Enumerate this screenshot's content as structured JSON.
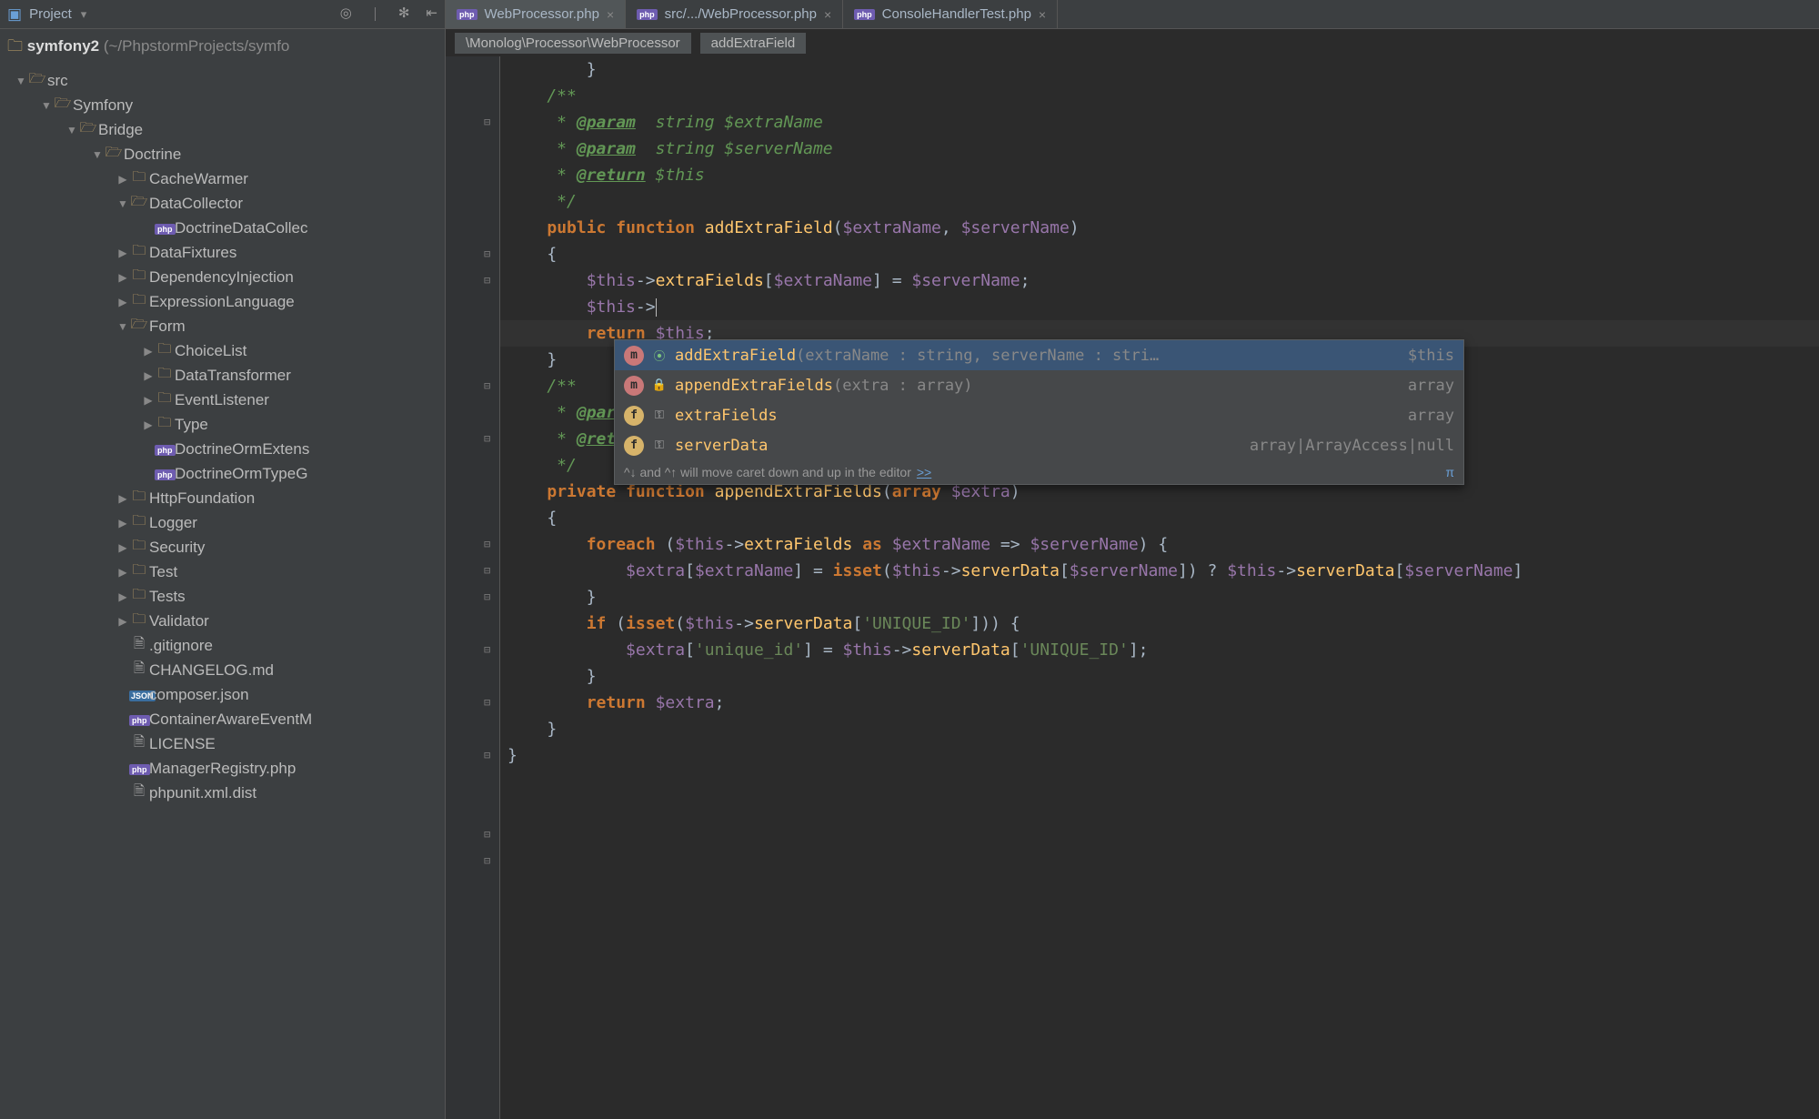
{
  "sidebar": {
    "toolbarLabel": "Project",
    "project": "symfony2",
    "projectLoc": "(~/PhpstormProjects/symfo",
    "tree": [
      {
        "depth": 0,
        "arrow": "down",
        "icon": "folder-open",
        "name": "src"
      },
      {
        "depth": 1,
        "arrow": "down",
        "icon": "folder-open",
        "name": "Symfony"
      },
      {
        "depth": 2,
        "arrow": "down",
        "icon": "folder-open",
        "name": "Bridge"
      },
      {
        "depth": 3,
        "arrow": "down",
        "icon": "folder-open",
        "name": "Doctrine"
      },
      {
        "depth": 4,
        "arrow": "right",
        "icon": "folder",
        "name": "CacheWarmer"
      },
      {
        "depth": 4,
        "arrow": "down",
        "icon": "folder-open",
        "name": "DataCollector"
      },
      {
        "depth": 5,
        "arrow": "",
        "icon": "php",
        "name": "DoctrineDataCollec"
      },
      {
        "depth": 4,
        "arrow": "right",
        "icon": "folder",
        "name": "DataFixtures"
      },
      {
        "depth": 4,
        "arrow": "right",
        "icon": "folder",
        "name": "DependencyInjection"
      },
      {
        "depth": 4,
        "arrow": "right",
        "icon": "folder",
        "name": "ExpressionLanguage"
      },
      {
        "depth": 4,
        "arrow": "down",
        "icon": "folder-open",
        "name": "Form"
      },
      {
        "depth": 5,
        "arrow": "right",
        "icon": "folder",
        "name": "ChoiceList"
      },
      {
        "depth": 5,
        "arrow": "right",
        "icon": "folder",
        "name": "DataTransformer"
      },
      {
        "depth": 5,
        "arrow": "right",
        "icon": "folder",
        "name": "EventListener"
      },
      {
        "depth": 5,
        "arrow": "right",
        "icon": "folder",
        "name": "Type"
      },
      {
        "depth": 5,
        "arrow": "",
        "icon": "php",
        "name": "DoctrineOrmExtens"
      },
      {
        "depth": 5,
        "arrow": "",
        "icon": "php",
        "name": "DoctrineOrmTypeG"
      },
      {
        "depth": 4,
        "arrow": "right",
        "icon": "folder",
        "name": "HttpFoundation"
      },
      {
        "depth": 4,
        "arrow": "right",
        "icon": "folder",
        "name": "Logger"
      },
      {
        "depth": 4,
        "arrow": "right",
        "icon": "folder",
        "name": "Security"
      },
      {
        "depth": 4,
        "arrow": "right",
        "icon": "folder",
        "name": "Test"
      },
      {
        "depth": 4,
        "arrow": "right",
        "icon": "folder",
        "name": "Tests"
      },
      {
        "depth": 4,
        "arrow": "right",
        "icon": "folder",
        "name": "Validator"
      },
      {
        "depth": 4,
        "arrow": "",
        "icon": "file",
        "name": ".gitignore"
      },
      {
        "depth": 4,
        "arrow": "",
        "icon": "file",
        "name": "CHANGELOG.md"
      },
      {
        "depth": 4,
        "arrow": "",
        "icon": "json",
        "name": "composer.json"
      },
      {
        "depth": 4,
        "arrow": "",
        "icon": "php",
        "name": "ContainerAwareEventM"
      },
      {
        "depth": 4,
        "arrow": "",
        "icon": "file",
        "name": "LICENSE"
      },
      {
        "depth": 4,
        "arrow": "",
        "icon": "php",
        "name": "ManagerRegistry.php"
      },
      {
        "depth": 4,
        "arrow": "",
        "icon": "file",
        "name": "phpunit.xml.dist"
      }
    ]
  },
  "tabs": [
    {
      "label": "WebProcessor.php",
      "active": true
    },
    {
      "label": "src/.../WebProcessor.php",
      "active": false
    },
    {
      "label": "ConsoleHandlerTest.php",
      "active": false
    }
  ],
  "breadcrumb": [
    "\\Monolog\\Processor\\WebProcessor",
    "addExtraField"
  ],
  "code": {
    "lines": [
      "        }",
      "",
      "    /**",
      "     * @param  string $extraName",
      "     * @param  string $serverName",
      "     * @return $this",
      "     */",
      "    public function addExtraField($extraName, $serverName)",
      "    {",
      "        $this->extraFields[$extraName] = $serverName;",
      "        $this->",
      "        return $this;",
      "    }",
      "",
      "    /**",
      "     * @param  array $extra",
      "     * @return array",
      "     */",
      "    private function appendExtraFields(array $extra)",
      "    {",
      "        foreach ($this->extraFields as $extraName => $serverName) {",
      "            $extra[$extraName] = isset($this->serverData[$serverName]) ? $this->serverData[$serverName]",
      "        }",
      "",
      "        if (isset($this->serverData['UNIQUE_ID'])) {",
      "            $extra['unique_id'] = $this->serverData['UNIQUE_ID'];",
      "        }",
      "",
      "        return $extra;",
      "    }",
      "}"
    ]
  },
  "popup": {
    "items": [
      {
        "kind": "m",
        "vis": "pub",
        "name": "addExtraField",
        "sig": "(extraName : string, serverName : stri…",
        "ret": "$this",
        "selected": true
      },
      {
        "kind": "m",
        "vis": "priv",
        "name": "appendExtraFields",
        "sig": "(extra : array)",
        "ret": "array",
        "selected": false
      },
      {
        "kind": "f",
        "vis": "prot",
        "name": "extraFields",
        "sig": "",
        "ret": "array",
        "selected": false
      },
      {
        "kind": "f",
        "vis": "prot",
        "name": "serverData",
        "sig": "",
        "ret": "array|ArrayAccess|null",
        "selected": false
      }
    ],
    "hint": "^↓ and ^↑ will move caret down and up in the editor",
    "hintLink": ">>",
    "pi": "π"
  }
}
